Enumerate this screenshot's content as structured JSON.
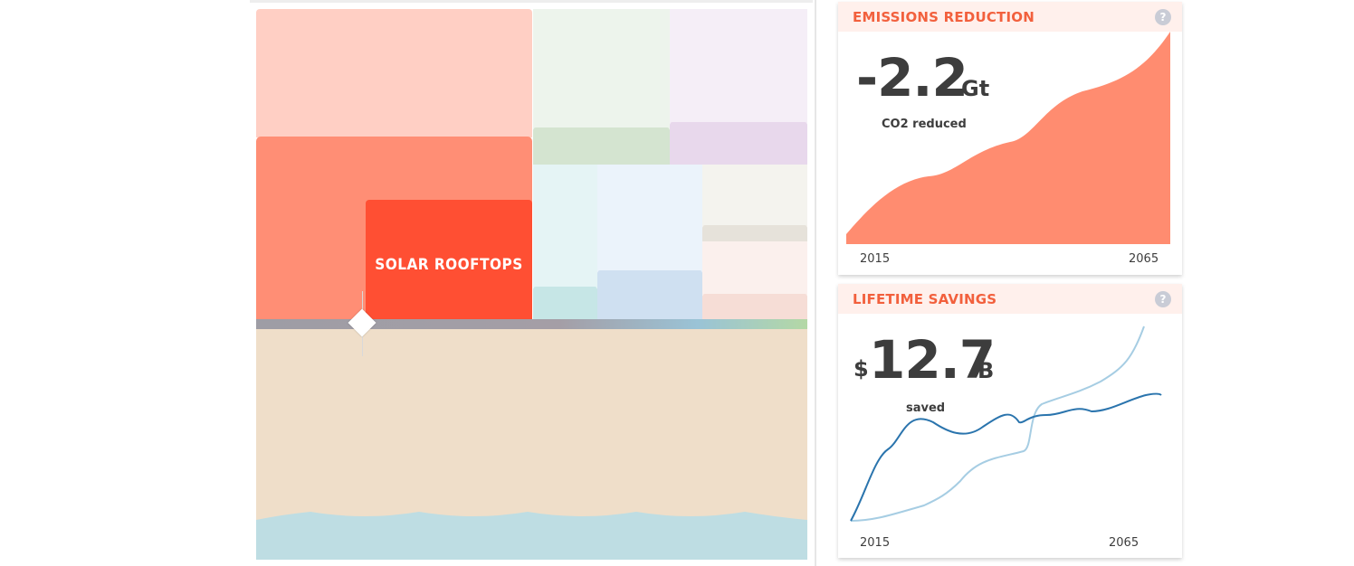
{
  "treemap": {
    "highlight_label": "SOLAR ROOFTOPS"
  },
  "emissions_card": {
    "title": "EMISSIONS REDUCTION",
    "value": "-2.2",
    "unit": "Gt",
    "caption": "CO2 reduced",
    "year_start": "2015",
    "year_end": "2065",
    "color": "#ff8c70"
  },
  "savings_card": {
    "title": "LIFETIME SAVINGS",
    "currency": "$",
    "value": "12.7",
    "unit": "B",
    "caption": "saved",
    "year_start": "2015",
    "year_end": "2065",
    "line_dark_color": "#2a74ad",
    "line_light_color": "#a6cde3"
  },
  "help_icon_glyph": "?",
  "colors": {
    "accent": "#f2603d",
    "highlight": "#ff4f33"
  }
}
